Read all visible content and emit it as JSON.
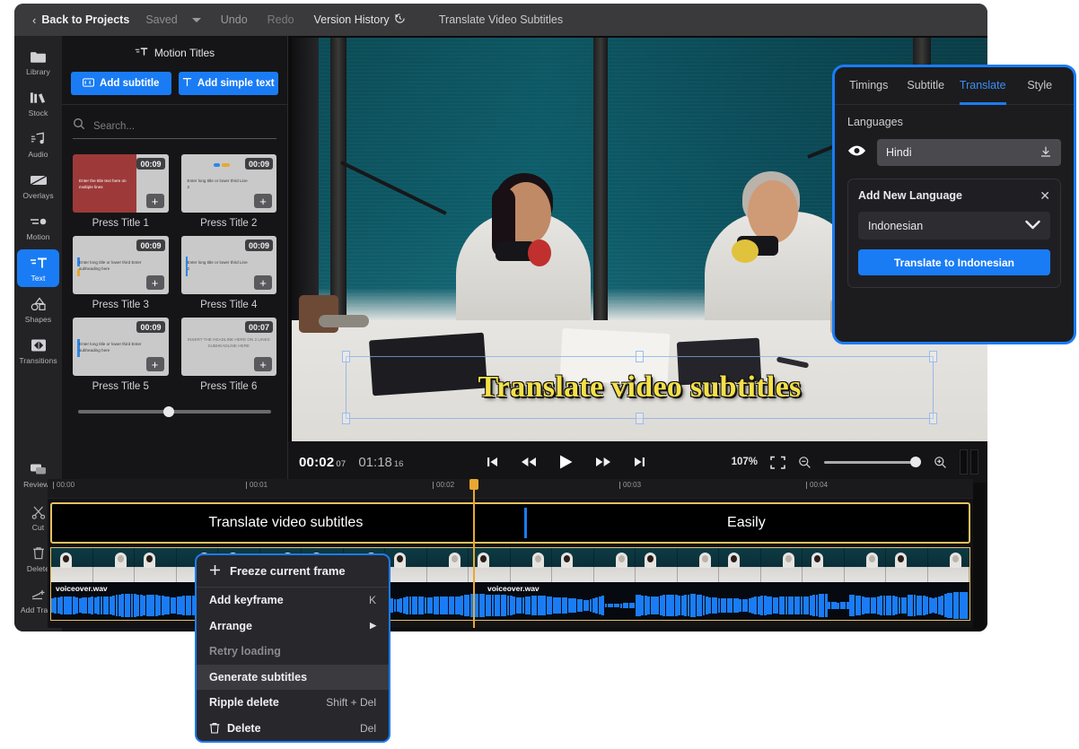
{
  "titlebar": {
    "back_label": "Back to Projects",
    "saved_label": "Saved",
    "undo_label": "Undo",
    "redo_label": "Redo",
    "version_history_label": "Version History",
    "project_title": "Translate Video Subtitles"
  },
  "rail": {
    "items": [
      {
        "label": "Library",
        "icon": "folder-icon",
        "active": false
      },
      {
        "label": "Stock",
        "icon": "stock-icon",
        "active": false
      },
      {
        "label": "Audio",
        "icon": "audio-note-icon",
        "active": false
      },
      {
        "label": "Overlays",
        "icon": "overlays-icon",
        "active": false
      },
      {
        "label": "Motion",
        "icon": "motion-icon",
        "active": false
      },
      {
        "label": "Text",
        "icon": "text-icon",
        "active": true
      },
      {
        "label": "Shapes",
        "icon": "shapes-icon",
        "active": false
      },
      {
        "label": "Transitions",
        "icon": "transitions-icon",
        "active": false
      },
      {
        "label": "Reviews",
        "icon": "reviews-icon",
        "active": false
      }
    ],
    "bottom_items": [
      {
        "label": "Cut",
        "icon": "scissors-icon"
      },
      {
        "label": "Delete",
        "icon": "trash-icon"
      },
      {
        "label": "Add Track",
        "icon": "add-track-icon"
      }
    ]
  },
  "motion_titles": {
    "header": "Motion Titles",
    "add_subtitle_label": "Add subtitle",
    "add_simple_text_label": "Add simple text",
    "search_placeholder": "Search...",
    "search_value": "",
    "tiles": [
      {
        "caption": "Press Title 1",
        "duration": "00:09",
        "preview": "Enter the title text here on multiple lines",
        "style": "red",
        "add_label": "+"
      },
      {
        "caption": "Press Title 2",
        "duration": "00:09",
        "preview": "Enter long title or lower third\nLine 2",
        "style": "gray-dots",
        "add_label": "+"
      },
      {
        "caption": "Press Title 3",
        "duration": "00:09",
        "preview": "Enter long title or lower third\nEnter subheading here",
        "style": "gray-bars",
        "add_label": "+"
      },
      {
        "caption": "Press Title 4",
        "duration": "00:09",
        "preview": "Enter long title or lower third\nLine 2",
        "style": "gray-bar-blue",
        "add_label": "+"
      },
      {
        "caption": "Press Title 5",
        "duration": "00:09",
        "preview": "Enter long title or lower third\nEnter subheading here",
        "style": "gray-bar-blue",
        "add_label": "+"
      },
      {
        "caption": "Press Title 6",
        "duration": "00:07",
        "preview": "INSERT THE\nHEADLINE HERE ON 2 LINES\nSUBHEADLINE HERE",
        "style": "gray-center",
        "add_label": "+"
      }
    ],
    "zoom_slider_value": 44
  },
  "preview": {
    "subtitle_text": "Translate video subtitles"
  },
  "controls": {
    "current_time": "00:02",
    "current_frames": "07",
    "total_time": "01:18",
    "total_frames": "16",
    "zoom_level": "107%",
    "buttons": [
      {
        "name": "skip-to-start-button",
        "icon": "skip-start-icon"
      },
      {
        "name": "rewind-button",
        "icon": "rewind-icon"
      },
      {
        "name": "play-button",
        "icon": "play-icon"
      },
      {
        "name": "fast-forward-button",
        "icon": "fast-forward-icon"
      },
      {
        "name": "skip-to-end-button",
        "icon": "skip-end-icon"
      }
    ],
    "fullscreen_icon": "fullscreen-icon",
    "zoom_out_icon": "zoom-out-icon",
    "zoom_in_icon": "zoom-in-icon",
    "split_view_icon": "split-view-icon",
    "zoom_slider_value": 100
  },
  "timeline": {
    "ticks": [
      "00:00",
      "00:01",
      "00:02",
      "00:03",
      "00:04"
    ],
    "subtitle_clips": [
      {
        "label": "Translate video subtitles",
        "left_pct": 0,
        "width_pct": 51
      },
      {
        "label": "Easily",
        "left_pct": 51.5,
        "width_pct": 48.5
      }
    ],
    "audio_clip_name": "voiceover.wav",
    "audio_clip_name_2": "voiceover.wav",
    "playhead_pct": 46
  },
  "translate_panel": {
    "tabs": [
      {
        "label": "Timings",
        "active": false
      },
      {
        "label": "Subtitle",
        "active": false
      },
      {
        "label": "Translate",
        "active": true
      },
      {
        "label": "Style",
        "active": false
      }
    ],
    "languages_label": "Languages",
    "current_language": "Hindi",
    "eye_icon": "eye-icon",
    "download_icon": "download-icon",
    "add_new_language_title": "Add New Language",
    "close_icon": "close-icon",
    "selected_new_language": "Indonesian",
    "dropdown_icon": "chevron-down-icon",
    "translate_cta": "Translate to Indonesian"
  },
  "context_menu": {
    "items": [
      {
        "label": "Freeze current frame",
        "shortcut": "",
        "icon": "plus-icon",
        "state": "first"
      },
      {
        "label": "Add keyframe",
        "shortcut": "K",
        "icon": "",
        "state": "normal"
      },
      {
        "label": "Arrange",
        "shortcut": "",
        "icon": "",
        "state": "submenu"
      },
      {
        "label": "Retry loading",
        "shortcut": "",
        "icon": "",
        "state": "disabled"
      },
      {
        "label": "Generate subtitles",
        "shortcut": "",
        "icon": "",
        "state": "highlighted"
      },
      {
        "label": "Ripple delete",
        "shortcut": "Shift + Del",
        "icon": "",
        "state": "normal"
      },
      {
        "label": "Delete",
        "shortcut": "Del",
        "icon": "trash-icon",
        "state": "normal"
      }
    ]
  },
  "colors": {
    "accent_blue": "#1a7cf5",
    "timeline_select": "#e6c15e",
    "playhead": "#e8a82f",
    "subtitle_yellow": "#f5e04a"
  }
}
